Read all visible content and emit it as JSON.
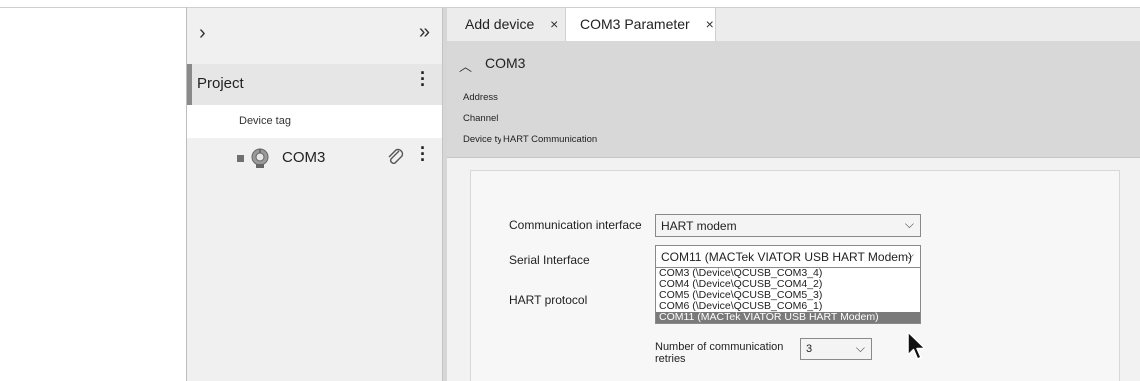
{
  "sidebar": {
    "expand_glyph": "›",
    "collapse_glyph": "»",
    "project_label": "Project",
    "device_tag_label": "Device tag",
    "device_label": "COM3"
  },
  "tabs": [
    {
      "label": "Add device",
      "close": "×"
    },
    {
      "label": "COM3 Parameter",
      "close": "×"
    }
  ],
  "header": {
    "title": "COM3",
    "fields": [
      {
        "label": "Address",
        "value": ""
      },
      {
        "label": "Channel",
        "value": ""
      },
      {
        "label": "Device type",
        "value": "HART Communication"
      }
    ]
  },
  "form": {
    "communication_interface": {
      "label": "Communication interface",
      "value": "HART modem"
    },
    "serial_interface": {
      "label": "Serial Interface",
      "value": "COM11 (MACTek VIATOR USB HART Modem)",
      "options": [
        "COM3 (\\Device\\QCUSB_COM3_4)",
        "COM4 (\\Device\\QCUSB_COM4_2)",
        "COM5 (\\Device\\QCUSB_COM5_3)",
        "COM6 (\\Device\\QCUSB_COM6_1)",
        "COM11 (MACTek VIATOR USB HART Modem)"
      ],
      "selected_index": 4
    },
    "hart_protocol": {
      "label": "HART protocol"
    },
    "retries": {
      "label": "Number of communication retries",
      "value": "3"
    }
  },
  "colors": {
    "sidebar_bg": "#f0f0f0",
    "header_bg": "#d8d8d8",
    "selected_option_bg": "#7a7a7a",
    "accent_bar": "#8a8a8a"
  }
}
